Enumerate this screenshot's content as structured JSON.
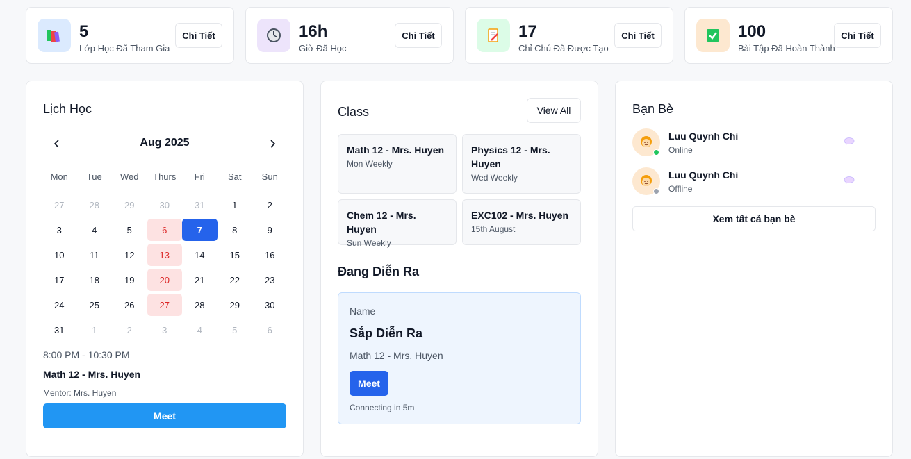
{
  "stats": [
    {
      "value": "5",
      "label": "Lớp Học Đã Tham Gia",
      "button": "Chi Tiết",
      "icon": "books-icon",
      "icon_bg": "#dbeafe"
    },
    {
      "value": "16h",
      "label": "Giờ Đã Học",
      "button": "Chi Tiết",
      "icon": "clock-icon",
      "icon_bg": "#ede4fb"
    },
    {
      "value": "17",
      "label": "Chỉ Chú Đã Được Tạo",
      "button": "Chi Tiết",
      "icon": "memo-icon",
      "icon_bg": "#dcfce7"
    },
    {
      "value": "100",
      "label": "Bài Tập Đã Hoàn Thành",
      "button": "Chi Tiết",
      "icon": "check-box-icon",
      "icon_bg": "#fde8d0"
    }
  ],
  "schedule": {
    "title": "Lịch Học",
    "month": "Aug 2025",
    "weekdays": [
      "Mon",
      "Tue",
      "Wed",
      "Thurs",
      "Fri",
      "Sat",
      "Sun"
    ],
    "weeks": [
      [
        "27",
        "28",
        "29",
        "30",
        "31",
        "1",
        "2"
      ],
      [
        "3",
        "4",
        "5",
        "6",
        "7",
        "8",
        "9"
      ],
      [
        "10",
        "11",
        "12",
        "13",
        "14",
        "15",
        "16"
      ],
      [
        "17",
        "18",
        "19",
        "20",
        "21",
        "22",
        "23"
      ],
      [
        "24",
        "25",
        "26",
        "27",
        "28",
        "29",
        "30"
      ],
      [
        "31",
        "1",
        "2",
        "3",
        "4",
        "5",
        "6"
      ]
    ],
    "event": {
      "time": "8:00 PM - 10:30 PM",
      "title": "Math 12 - Mrs. Huyen",
      "mentor": "Mentor: Mrs. Huyen",
      "button": "Meet"
    }
  },
  "classes": {
    "title": "Class",
    "view_all": "View All",
    "items": [
      {
        "name": "Math 12 - Mrs. Huyen",
        "schedule": "Mon Weekly"
      },
      {
        "name": "Physics 12 - Mrs. Huyen",
        "schedule": "Wed Weekly"
      },
      {
        "name": "Chem 12 - Mrs. Huyen",
        "schedule": "Sun Weekly"
      },
      {
        "name": "EXC102 - Mrs. Huyen",
        "schedule": "15th August"
      }
    ],
    "live": {
      "title": "Đang Diễn Ra",
      "name_label": "Name",
      "status": "Sắp Diễn Ra",
      "class": "Math 12 - Mrs. Huyen",
      "button": "Meet",
      "connecting": "Connecting in 5m"
    }
  },
  "friends": {
    "title": "Bạn Bè",
    "items": [
      {
        "name": "Luu Quynh Chi",
        "status": "Online",
        "status_color": "#22c55e"
      },
      {
        "name": "Luu Quynh Chi",
        "status": "Offline",
        "status_color": "#9ca3af"
      }
    ],
    "see_all": "Xem tất cả bạn bè"
  },
  "colors": {
    "accent": "#2563eb",
    "meet_button": "#2196f3",
    "highlight_day": "#fde2e2"
  }
}
